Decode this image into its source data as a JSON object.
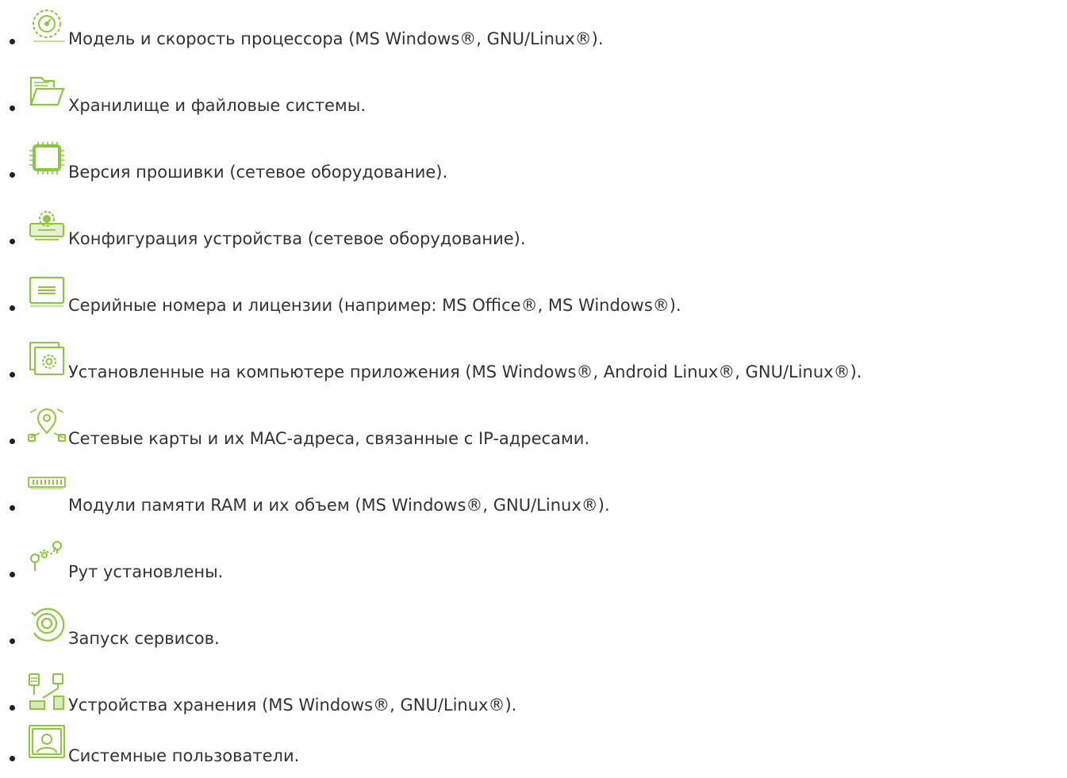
{
  "accent_color": "#8dc63f",
  "features": [
    {
      "icon": "cpu-speed-gear-icon",
      "text": "Модель и скорость процессора (MS Windows®, GNU/Linux®)."
    },
    {
      "icon": "folder-icon",
      "text": "Хранилище и файловые системы."
    },
    {
      "icon": "chip-icon",
      "text": "Версия прошивки (сетевое оборудование)."
    },
    {
      "icon": "device-config-gear-icon",
      "text": "Конфигурация устройства (сетевое оборудование)."
    },
    {
      "icon": "license-card-icon",
      "text": "Серийные номера и лицензии (например: MS Office®, MS Windows®)."
    },
    {
      "icon": "app-window-gear-icon",
      "text": "Установленные на компьютере приложения (MS Windows®, Android Linux®, GNU/Linux®)."
    },
    {
      "icon": "network-location-icon",
      "text": "Сетевые карты и их MAC-адреса, связанные с IP-адресами."
    },
    {
      "icon": "ram-module-icon",
      "text": "Модули памяти RAM и их объем (MS Windows®, GNU/Linux®)."
    },
    {
      "icon": "route-path-icon",
      "text": "Рут установлены."
    },
    {
      "icon": "service-target-icon",
      "text": "Запуск сервисов."
    },
    {
      "icon": "storage-network-icon",
      "text": "Устройства хранения (MS Windows®, GNU/Linux®)."
    },
    {
      "icon": "user-profile-icon",
      "text": "Системные пользователи."
    }
  ]
}
